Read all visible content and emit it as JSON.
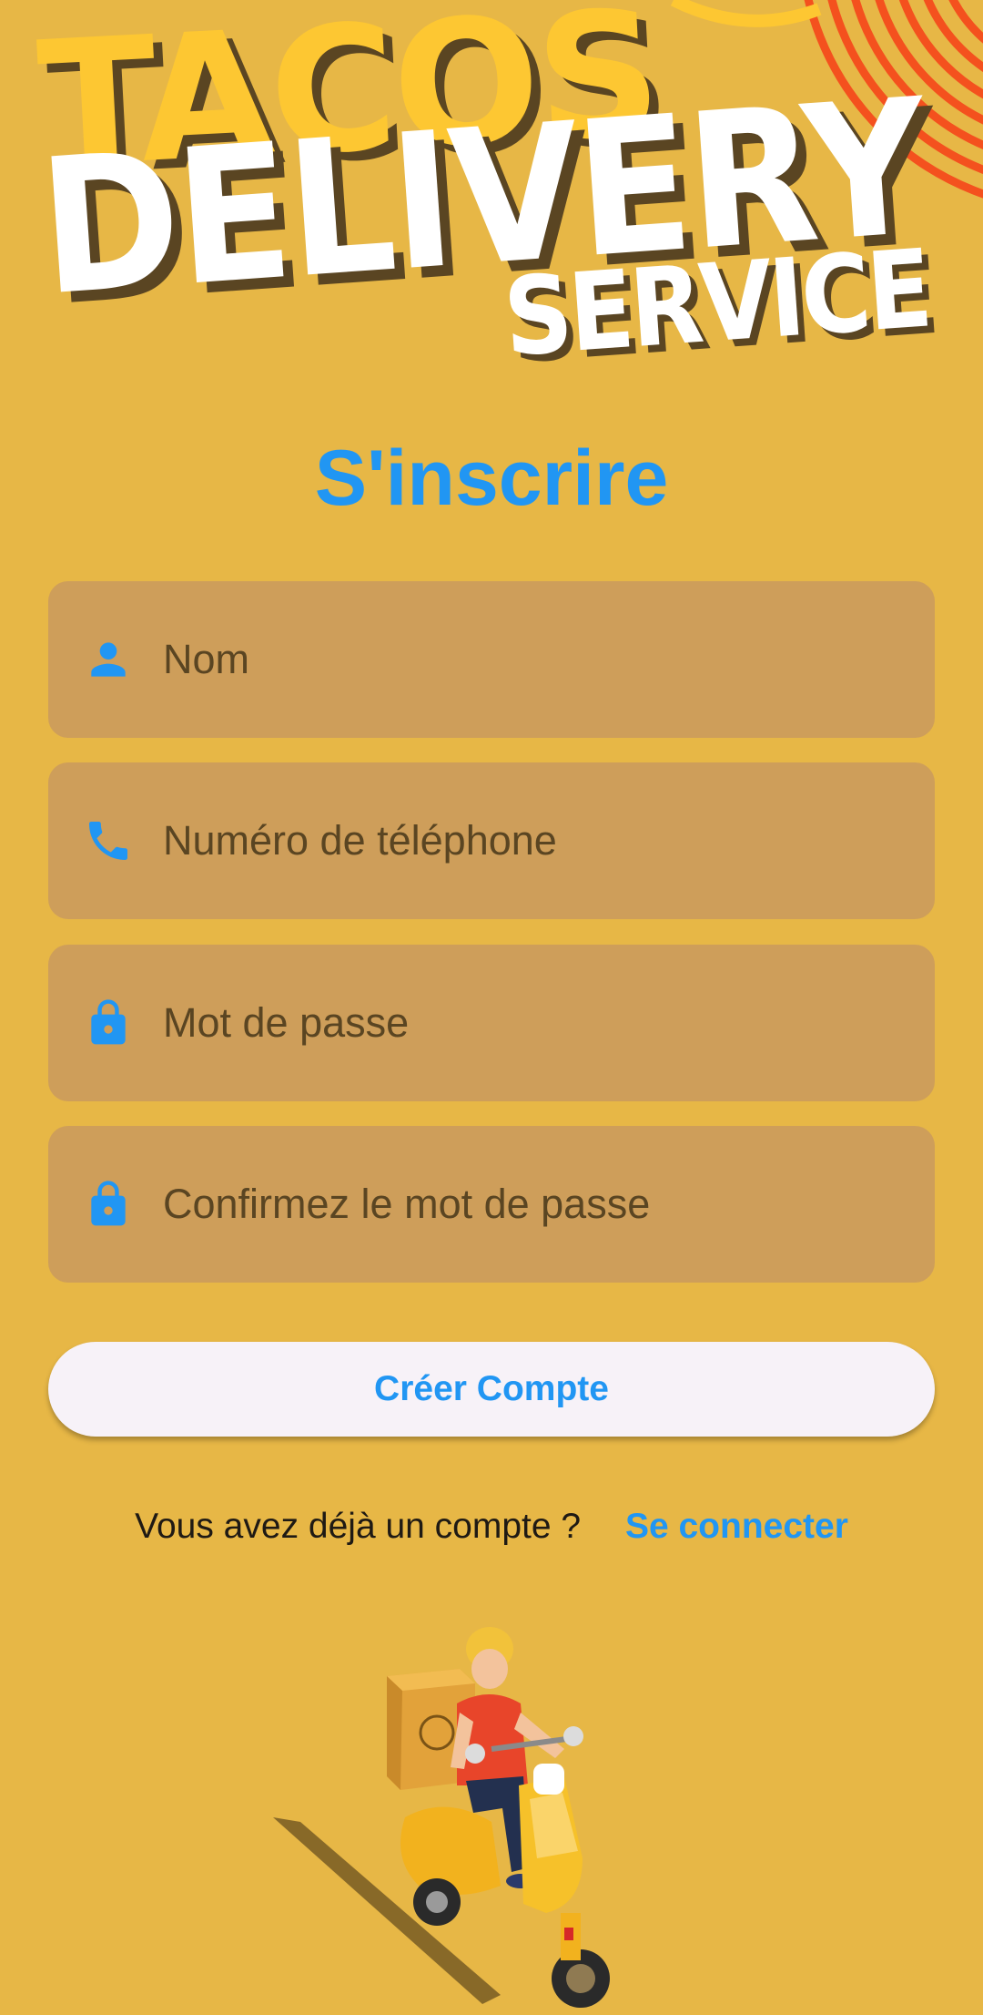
{
  "logo": {
    "line1": "TACOS",
    "line2": "DELIVERY",
    "line3": "SERVICE"
  },
  "title": "S'inscrire",
  "form": {
    "name_placeholder": "Nom",
    "phone_placeholder": "Numéro de téléphone",
    "password_placeholder": "Mot de passe",
    "confirm_placeholder": "Confirmez le mot de passe",
    "icons": [
      "person-icon",
      "phone-icon",
      "lock-icon",
      "lock-icon"
    ]
  },
  "create_button_label": "Créer Compte",
  "login_prompt": {
    "question": "Vous avez déjà un compte ?",
    "link": "Se connecter"
  },
  "illustration": {
    "description": "delivery-scooter-rider"
  },
  "colors": {
    "background": "#E7B746",
    "accent": "#2196F3",
    "field_background": "#CE9E5A",
    "field_text": "#5A4522",
    "button_background": "#F7F2F8",
    "logo_yellow": "#FDC732",
    "logo_white": "#FFFFFF",
    "stripes": "#F4511E"
  }
}
